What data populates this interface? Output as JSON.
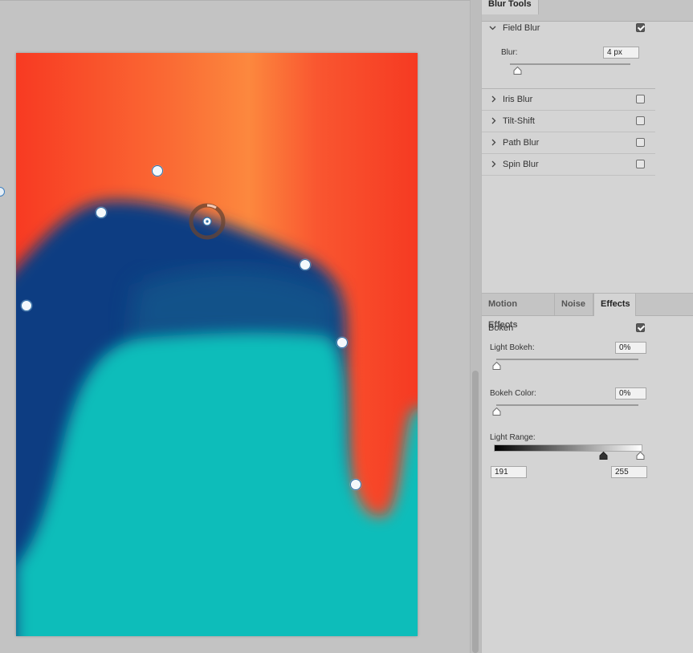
{
  "blur_tools": {
    "tab_label": "Blur Tools",
    "field_blur": {
      "label": "Field Blur",
      "checked": true,
      "blur_label": "Blur:",
      "blur_value": "4 px",
      "blur_level": 0.04
    },
    "items": [
      {
        "label": "Iris Blur",
        "checked": false
      },
      {
        "label": "Tilt-Shift",
        "checked": false
      },
      {
        "label": "Path Blur",
        "checked": false
      },
      {
        "label": "Spin Blur",
        "checked": false
      }
    ]
  },
  "effects_panel": {
    "tabs": [
      {
        "label": "Motion Effects",
        "active": false
      },
      {
        "label": "Noise",
        "active": false
      },
      {
        "label": "Effects",
        "active": true
      }
    ],
    "bokeh": {
      "label": "Bokeh",
      "checked": true
    },
    "light_bokeh": {
      "label": "Light Bokeh:",
      "value": "0%",
      "level": 0
    },
    "bokeh_color": {
      "label": "Bokeh Color:",
      "value": "0%",
      "level": 0
    },
    "light_range": {
      "label": "Light Range:",
      "low": "191",
      "high": "255"
    }
  },
  "colors": {
    "red": "#f83c24",
    "orange": "#fb823c",
    "navy": "#0b3d82",
    "teal": "#0bbdba"
  },
  "icons": [
    "chevron-down-icon",
    "chevron-right-icon",
    "checkbox-icon",
    "slider-thumb-icon",
    "blur-pin-icon"
  ]
}
